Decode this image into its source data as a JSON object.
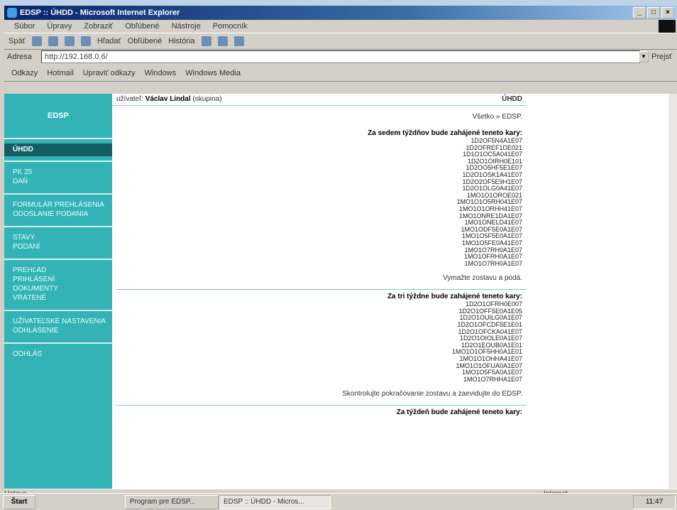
{
  "window": {
    "title": "EDSP :: ÚHDD - Microsoft Internet Explorer"
  },
  "menubar": {
    "items": [
      "Súbor",
      "Úpravy",
      "Zobraziť",
      "Obľúbené",
      "Nástroje",
      "Pomocník"
    ]
  },
  "toolbar": {
    "back": "Späť",
    "search": "Hľadať",
    "favorites": "Obľúbené",
    "history": "História"
  },
  "addressbar": {
    "label": "Adresa",
    "url": "http://192.168.0.6/",
    "go": "Prejsť"
  },
  "linksbar": {
    "label": "Odkazy",
    "items": [
      "Hotmail",
      "Upraviť odkazy",
      "Windows",
      "Windows Media"
    ]
  },
  "sidebar": {
    "brand": "EDSP",
    "active": "ÚHDD",
    "groups": [
      [
        "PK 25",
        "DAŇ"
      ],
      [
        "FORMULÁR PREHLÁSENIA",
        "ODOSLANIE PODANIA"
      ],
      [
        "STAVY",
        "PODANÍ"
      ],
      [
        "PREHĽAD",
        "PRIHLÁSENÍ",
        "DOKUMENTY",
        "VRÁTENÉ"
      ],
      [
        "UŽÍVATEĽSKÉ NASTAVENIA",
        "ODHLÁSENIE"
      ],
      [
        "ODHLÁS"
      ]
    ]
  },
  "main": {
    "user_prefix": "užívateľ:",
    "user_name": "Václav Lindal",
    "user_suffix": "(skupina)",
    "section": "ÚHDD",
    "vsetko": "Všetko » EDSP.",
    "block1": {
      "heading": "Za sedem týždňov bude zahájené teneto kary:",
      "codes": [
        "1D2OF5N4A1E07",
        "1D2OFREF1DE021",
        "1D1O1OC5A041E07",
        "1D2O1OIRH0E101",
        "1D2OO5HF5E1E07",
        "1D2O1OSK1A41E07",
        "1D2O2OF5E9H1E07",
        "1D2O1OLG0A41E07",
        "1MO1O1OROE021",
        "1MO1O1O5RH041E07",
        "1MO1O1ORHH41E07",
        "1MO1ONRE1DA1E07",
        "1MO1ONELD41E07",
        "1MO1ODF5E0A1E07",
        "1MO1O5F5E0A1E07",
        "1MO1O5FE0A41E07",
        "1MO1O7RH0A1E07",
        "1MO1OFRH0A1E07",
        "1MO1O7RH0A1E07"
      ],
      "note": "Vymažte zostavu a podá."
    },
    "block2": {
      "heading": "Za tri týždne bude zahájené teneto kary:",
      "codes": [
        "1D2O1OFRH0E007",
        "1D2O1OFF5E0A1E05",
        "1D2O1OUILG0A1E07",
        "1D2O1OFCDF5E1E01",
        "1D2O1OFCKA041E07",
        "1D2O1OIOLE0A1E07",
        "1D2O1EOUB0A1E01",
        "1MO1O1OF5HH0A1E01",
        "1MO1O1OHHA41E07",
        "1MO1O1OFUA0A1E07",
        "1MO1O5F5A0A1E07",
        "1MO1O7RHHA1E07"
      ],
      "note": "Skontrolujte pokračovanie zostavu a zaevidujte do EDSP."
    },
    "block3": {
      "heading": "Za týždeň bude zahájené teneto kary:"
    }
  },
  "statusbar": {
    "left": "Hotovo",
    "zone": "Internet"
  },
  "taskbar": {
    "start": "Štart",
    "tasks": [
      "Program pre EDSP...",
      "EDSP :: ÚHDD - Micros..."
    ],
    "clock": "11:47"
  }
}
